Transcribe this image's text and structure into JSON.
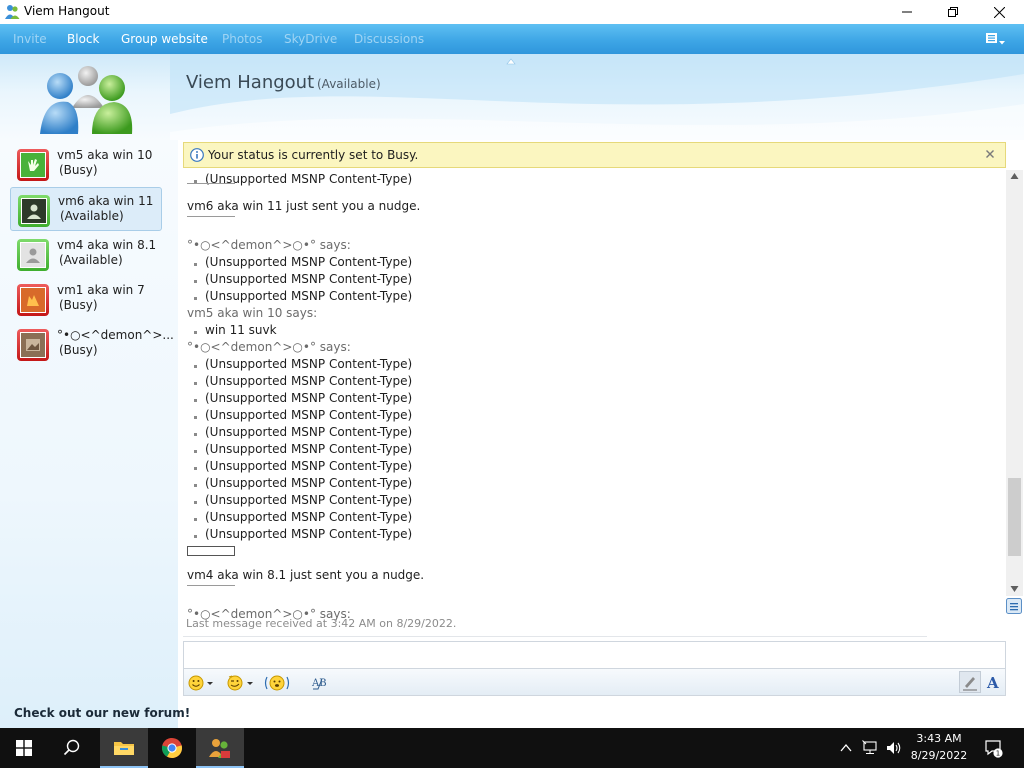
{
  "window": {
    "title": "Viem Hangout"
  },
  "menu": {
    "items": [
      {
        "label": "Invite",
        "enabled": false
      },
      {
        "label": "Block",
        "enabled": true
      },
      {
        "label": "Group website",
        "enabled": true
      },
      {
        "label": "Photos",
        "enabled": false
      },
      {
        "label": "SkyDrive",
        "enabled": false
      },
      {
        "label": "Discussions",
        "enabled": false
      }
    ]
  },
  "header": {
    "title": "Viem Hangout",
    "status": "(Available)"
  },
  "contacts": [
    {
      "name": "vm5 aka win 10",
      "status": "(Busy)",
      "presence": "busy",
      "selected": false
    },
    {
      "name": "vm6 aka win 11",
      "status": "(Available)",
      "presence": "available",
      "selected": true
    },
    {
      "name": "vm4 aka win 8.1",
      "status": "(Available)",
      "presence": "available",
      "selected": false
    },
    {
      "name": "vm1 aka win 7",
      "status": "(Busy)",
      "presence": "busy",
      "selected": false
    },
    {
      "name": "°•○<^demon^>...",
      "status": "(Busy)",
      "presence": "busy",
      "selected": false
    }
  ],
  "sidebar": {
    "forum_link": "Check out our new forum!"
  },
  "notification": {
    "text": "Your status is currently set to Busy."
  },
  "conversation": {
    "lines": [
      {
        "kind": "msg",
        "text": "(Unsupported MSNP Content-Type)"
      },
      {
        "kind": "hr"
      },
      {
        "kind": "nudge",
        "text": "vm6 aka win 11 just sent you a nudge."
      },
      {
        "kind": "hr"
      },
      {
        "kind": "gap"
      },
      {
        "kind": "says",
        "text": "°•○<^demon^>○•° says:"
      },
      {
        "kind": "msg",
        "text": "(Unsupported MSNP Content-Type)"
      },
      {
        "kind": "msg",
        "text": "(Unsupported MSNP Content-Type)"
      },
      {
        "kind": "msg",
        "text": "(Unsupported MSNP Content-Type)"
      },
      {
        "kind": "says",
        "text": "vm5 aka win 10 says:"
      },
      {
        "kind": "msg",
        "text": "win 11 suvk"
      },
      {
        "kind": "says",
        "text": "°•○<^demon^>○•° says:"
      },
      {
        "kind": "msg",
        "text": "(Unsupported MSNP Content-Type)"
      },
      {
        "kind": "msg",
        "text": "(Unsupported MSNP Content-Type)"
      },
      {
        "kind": "msg",
        "text": "(Unsupported MSNP Content-Type)"
      },
      {
        "kind": "msg",
        "text": "(Unsupported MSNP Content-Type)"
      },
      {
        "kind": "msg",
        "text": "(Unsupported MSNP Content-Type)"
      },
      {
        "kind": "msg",
        "text": "(Unsupported MSNP Content-Type)"
      },
      {
        "kind": "msg",
        "text": "(Unsupported MSNP Content-Type)"
      },
      {
        "kind": "msg",
        "text": "(Unsupported MSNP Content-Type)"
      },
      {
        "kind": "msg",
        "text": "(Unsupported MSNP Content-Type)"
      },
      {
        "kind": "msg",
        "text": "(Unsupported MSNP Content-Type)"
      },
      {
        "kind": "msg",
        "text": "(Unsupported MSNP Content-Type)"
      },
      {
        "kind": "box"
      },
      {
        "kind": "nudge",
        "text": "vm4 aka win 8.1 just sent you a nudge."
      },
      {
        "kind": "hr"
      },
      {
        "kind": "gap"
      },
      {
        "kind": "says",
        "text": "°•○<^demon^>○•° says:"
      }
    ],
    "last_received": "Last message received at 3:42 AM on 8/29/2022."
  },
  "input": {
    "value": "",
    "placeholder": ""
  },
  "toolbar": {
    "buttons": [
      "emoticon-icon",
      "wink-icon",
      "nudge-icon",
      "spellcheck-icon",
      "handwriting-icon",
      "font-icon"
    ]
  },
  "taskbar": {
    "apps": [
      "start-icon",
      "search-icon",
      "file-explorer-icon",
      "chrome-icon",
      "messenger-icon"
    ],
    "time": "3:43 AM",
    "date": "8/29/2022",
    "notification_count": "1"
  },
  "colors": {
    "menubar": "#3ea6e6",
    "busy": "#d42020",
    "available": "#3fae2e",
    "notification_bg": "#fbf6c0",
    "taskbar": "#101010"
  }
}
